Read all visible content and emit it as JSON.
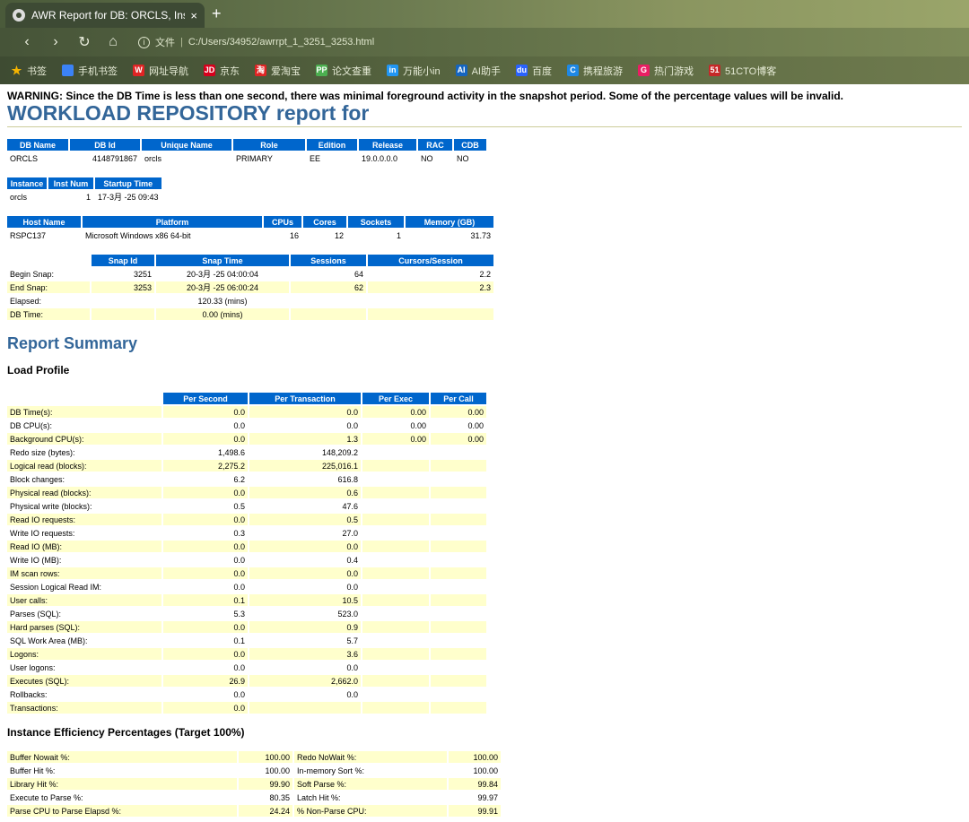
{
  "browser": {
    "tab_title": "AWR Report for DB: ORCLS, Ins",
    "close": "×",
    "new_tab": "+",
    "url_prefix": "文件",
    "url": "C:/Users/34952/awrrpt_1_3251_3253.html",
    "bookmarks": [
      {
        "label": "书签",
        "color": "#f5b400",
        "glyph": "★"
      },
      {
        "label": "手机书签",
        "color": "#3b82f6",
        "glyph": ""
      },
      {
        "label": "网址导航",
        "color": "#e02424",
        "glyph": "W"
      },
      {
        "label": "京东",
        "color": "#d6001c",
        "glyph": "JD"
      },
      {
        "label": "爱淘宝",
        "color": "#e02424",
        "glyph": "淘"
      },
      {
        "label": "论文查重",
        "color": "#4caf50",
        "glyph": "PP"
      },
      {
        "label": "万能小in",
        "color": "#2196f3",
        "glyph": "in"
      },
      {
        "label": "AI助手",
        "color": "#1565c0",
        "glyph": "AI"
      },
      {
        "label": "百度",
        "color": "#2962ff",
        "glyph": "du"
      },
      {
        "label": "携程旅游",
        "color": "#1e88e5",
        "glyph": "C"
      },
      {
        "label": "热门游戏",
        "color": "#e91e63",
        "glyph": "G"
      },
      {
        "label": "51CTO博客",
        "color": "#c62828",
        "glyph": "51"
      }
    ]
  },
  "report": {
    "warning": "WARNING: Since the DB Time is less than one second, there was minimal foreground activity in the snapshot period. Some of the percentage values will be invalid.",
    "title": "WORKLOAD REPOSITORY report for",
    "db_table": {
      "headers": [
        "DB Name",
        "DB Id",
        "Unique Name",
        "Role",
        "Edition",
        "Release",
        "RAC",
        "CDB"
      ],
      "row": [
        "ORCLS",
        "4148791867",
        "orcls",
        "PRIMARY",
        "EE",
        "19.0.0.0.0",
        "NO",
        "NO"
      ]
    },
    "instance_table": {
      "headers": [
        "Instance",
        "Inst Num",
        "Startup Time"
      ],
      "row": [
        "orcls",
        "1",
        "17-3月 -25 09:43"
      ]
    },
    "host_table": {
      "headers": [
        "Host Name",
        "Platform",
        "CPUs",
        "Cores",
        "Sockets",
        "Memory (GB)"
      ],
      "row": [
        "RSPC137",
        "Microsoft Windows x86 64-bit",
        "16",
        "12",
        "1",
        "31.73"
      ]
    },
    "snap_table": {
      "headers": [
        "",
        "Snap Id",
        "Snap Time",
        "Sessions",
        "Cursors/Session"
      ],
      "rows": [
        [
          "Begin Snap:",
          "3251",
          "20-3月 -25 04:00:04",
          "64",
          "2.2"
        ],
        [
          "End Snap:",
          "3253",
          "20-3月 -25 06:00:24",
          "62",
          "2.3"
        ],
        [
          "Elapsed:",
          "",
          "120.33 (mins)",
          "",
          ""
        ],
        [
          "DB Time:",
          "",
          "0.00 (mins)",
          "",
          ""
        ]
      ]
    },
    "summary_title": "Report Summary",
    "load_profile_title": "Load Profile",
    "load_profile": {
      "headers": [
        "",
        "Per Second",
        "Per Transaction",
        "Per Exec",
        "Per Call"
      ],
      "rows": [
        [
          "DB Time(s):",
          "0.0",
          "0.0",
          "0.00",
          "0.00"
        ],
        [
          "DB CPU(s):",
          "0.0",
          "0.0",
          "0.00",
          "0.00"
        ],
        [
          "Background CPU(s):",
          "0.0",
          "1.3",
          "0.00",
          "0.00"
        ],
        [
          "Redo size (bytes):",
          "1,498.6",
          "148,209.2",
          "",
          ""
        ],
        [
          "Logical read (blocks):",
          "2,275.2",
          "225,016.1",
          "",
          ""
        ],
        [
          "Block changes:",
          "6.2",
          "616.8",
          "",
          ""
        ],
        [
          "Physical read (blocks):",
          "0.0",
          "0.6",
          "",
          ""
        ],
        [
          "Physical write (blocks):",
          "0.5",
          "47.6",
          "",
          ""
        ],
        [
          "Read IO requests:",
          "0.0",
          "0.5",
          "",
          ""
        ],
        [
          "Write IO requests:",
          "0.3",
          "27.0",
          "",
          ""
        ],
        [
          "Read IO (MB):",
          "0.0",
          "0.0",
          "",
          ""
        ],
        [
          "Write IO (MB):",
          "0.0",
          "0.4",
          "",
          ""
        ],
        [
          "IM scan rows:",
          "0.0",
          "0.0",
          "",
          ""
        ],
        [
          "Session Logical Read IM:",
          "0.0",
          "0.0",
          "",
          ""
        ],
        [
          "User calls:",
          "0.1",
          "10.5",
          "",
          ""
        ],
        [
          "Parses (SQL):",
          "5.3",
          "523.0",
          "",
          ""
        ],
        [
          "Hard parses (SQL):",
          "0.0",
          "0.9",
          "",
          ""
        ],
        [
          "SQL Work Area (MB):",
          "0.1",
          "5.7",
          "",
          ""
        ],
        [
          "Logons:",
          "0.0",
          "3.6",
          "",
          ""
        ],
        [
          "User logons:",
          "0.0",
          "0.0",
          "",
          ""
        ],
        [
          "Executes (SQL):",
          "26.9",
          "2,662.0",
          "",
          ""
        ],
        [
          "Rollbacks:",
          "0.0",
          "0.0",
          "",
          ""
        ],
        [
          "Transactions:",
          "0.0",
          "",
          "",
          ""
        ]
      ]
    },
    "efficiency_title": "Instance Efficiency Percentages (Target 100%)",
    "efficiency": {
      "rows": [
        [
          "Buffer Nowait %:",
          "100.00",
          "Redo NoWait %:",
          "100.00"
        ],
        [
          "Buffer Hit %:",
          "100.00",
          "In-memory Sort %:",
          "100.00"
        ],
        [
          "Library Hit %:",
          "99.90",
          "Soft Parse %:",
          "99.84"
        ],
        [
          "Execute to Parse %:",
          "80.35",
          "Latch Hit %:",
          "99.97"
        ],
        [
          "Parse CPU to Parse Elapsd %:",
          "24.24",
          "% Non-Parse CPU:",
          "99.91"
        ]
      ]
    }
  }
}
